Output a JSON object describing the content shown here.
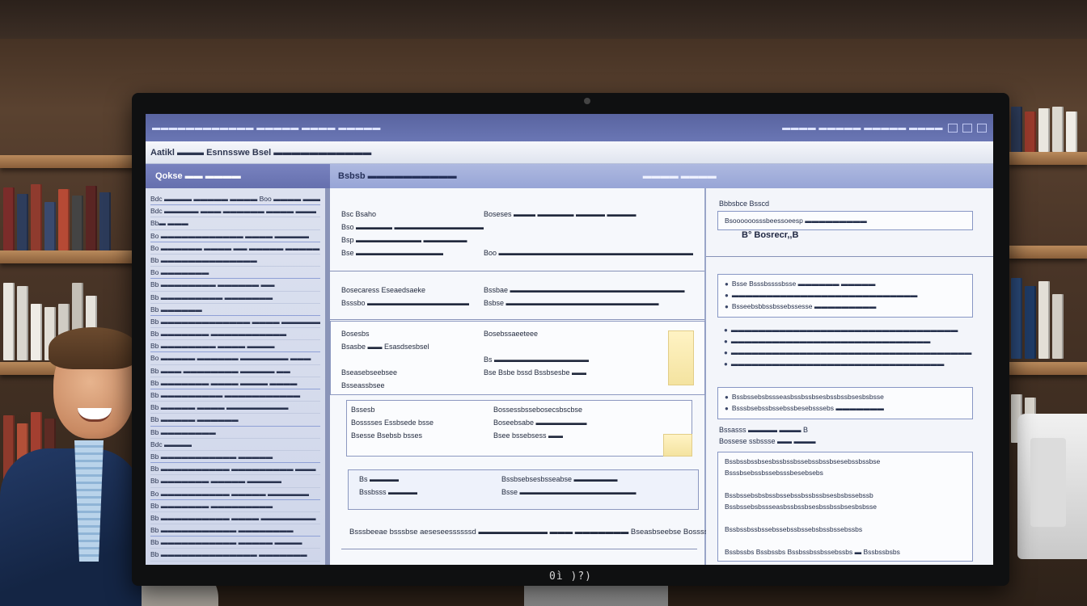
{
  "window": {
    "title_left": "▬▬▬▬▬▬▬▬▬▬▬▬ ▬▬▬▬▬ ▬▬▬▬ ▬▬▬▬▬",
    "title_right": "▬▬▬▬ ▬▬▬▬▬ ▬▬▬▬▬ ▬▬▬▬"
  },
  "ribbon": {
    "label": "Aatikl ▬▬▬ Esnnsswe Bsel ▬▬▬▬▬▬▬▬▬▬▬"
  },
  "left_band": {
    "label": "Qokse ▬▬ ▬▬▬▬"
  },
  "main_band": {
    "label": "Bsbsb ▬▬▬▬▬▬▬▬▬▬",
    "tab": "▬▬▬▬ ▬▬▬▬"
  },
  "left_pane": {
    "items": [
      "Bdc ▬▬▬▬ ▬▬▬▬▬ ▬▬▬▬ Boo ▬▬▬▬ ▬▬▬▬ ▬▬",
      "Bdc ▬▬▬▬▬ ▬▬▬ ▬▬▬▬▬▬ ▬▬▬▬ ▬▬▬",
      "Bb▬ ▬▬▬",
      "Bo ▬▬▬▬▬▬▬▬▬▬▬▬ ▬▬▬▬ ▬▬▬▬▬",
      "Bo ▬▬▬▬▬▬ ▬▬▬▬ ▬▬ ▬▬▬▬▬ ▬▬▬▬▬",
      "Bb ▬▬▬▬▬▬▬▬▬▬▬▬▬▬",
      "Bo ▬▬▬▬▬▬▬",
      "Bb ▬▬▬▬▬▬▬▬ ▬▬▬▬▬▬ ▬▬",
      "Bb ▬▬▬▬▬▬▬▬▬ ▬▬▬▬▬▬▬",
      "Bb ▬▬▬▬▬▬",
      "Bb ▬▬▬▬▬▬▬▬▬▬▬▬▬ ▬▬▬▬ ▬▬▬▬▬▬",
      "Bb ▬▬▬▬▬▬▬ ▬▬▬▬▬▬▬▬▬▬▬",
      "Bb ▬▬▬▬▬▬▬▬ ▬▬▬▬ ▬▬▬▬",
      "Bo ▬▬▬▬▬ ▬▬▬▬▬▬ ▬▬▬▬▬▬▬ ▬▬▬",
      "Bb ▬▬▬ ▬▬▬▬▬▬▬▬ ▬▬▬▬▬ ▬▬",
      "Bb ▬▬▬▬▬▬▬ ▬▬▬▬ ▬▬▬▬ ▬▬▬▬",
      "Bb ▬▬▬▬▬▬▬▬▬ ▬▬▬▬▬▬▬▬▬▬▬",
      "Bb ▬▬▬▬▬ ▬▬▬▬ ▬▬▬▬▬▬▬▬▬",
      "Bb ▬▬▬▬▬ ▬▬▬▬▬▬",
      "Bb ▬▬▬▬▬▬▬▬",
      "Bdc ▬▬▬▬",
      "Bb ▬▬▬▬▬▬▬▬▬▬▬ ▬▬▬▬▬",
      "Bb ▬▬▬▬▬▬▬▬▬▬ ▬▬▬▬▬▬▬▬▬ ▬▬▬",
      "Bb ▬▬▬▬▬▬▬ ▬▬▬▬▬ ▬▬▬▬▬",
      "Bo ▬▬▬▬▬▬▬▬▬▬ ▬▬▬▬▬ ▬▬▬▬▬▬",
      "Bb ▬▬▬▬▬▬▬ ▬▬▬▬▬▬▬▬▬",
      "Bb ▬▬▬▬▬▬▬▬▬▬ ▬▬▬▬ ▬▬▬▬▬▬▬▬",
      "Bb ▬▬▬▬▬▬▬▬▬▬▬ ▬▬▬▬▬▬▬▬",
      "Bb ▬▬▬▬▬▬▬▬▬▬▬ ▬▬▬▬▬ ▬▬▬▬",
      "Bb ▬▬▬▬▬▬▬▬▬▬▬▬▬▬ ▬▬▬▬▬▬▬",
      "Bb ▬▬▬▬▬▬▬ ▬▬▬▬▬▬▬▬▬ ▬▬▬",
      "Bb ▬▬▬▬▬▬▬▬▬▬▬ ▬▬▬▬▬▬"
    ]
  },
  "mid_pane": {
    "rows_a": [
      [
        "Bsc Bsaho",
        "Boseses ▬▬▬ ▬▬▬▬▬ ▬▬▬▬ ▬▬▬▬"
      ],
      [
        "Bso ▬▬▬▬▬ ▬▬▬▬▬▬▬▬▬▬▬▬▬",
        ""
      ],
      [
        "Bsp ▬▬▬▬▬▬▬▬▬ ▬▬▬▬▬▬",
        ""
      ],
      [
        "Bse ▬▬▬▬▬▬▬▬▬▬▬▬",
        "Boo ▬▬▬▬▬▬▬▬▬▬▬▬▬▬▬▬▬▬▬▬▬▬▬▬▬▬▬"
      ]
    ],
    "rows_b": [
      [
        "Bosecaress Eseaedsaeke",
        "Bssbae ▬▬▬▬▬▬▬▬▬▬▬▬▬▬▬▬▬▬▬▬▬▬▬▬"
      ],
      [
        "Bsssbo ▬▬▬▬▬▬▬▬▬▬▬▬▬▬",
        "Bsbse ▬▬▬▬▬▬▬▬▬▬▬▬▬▬▬▬▬▬▬▬▬"
      ]
    ],
    "rows_c": [
      [
        "Bosesbs",
        "Bosebssaeeteee"
      ],
      [
        "Bsasbe ▬▬ Esasdsesbsel",
        ""
      ],
      [
        "",
        "Bs ▬▬▬▬▬▬▬▬▬▬▬▬▬"
      ],
      [
        "Bseasebseebsee",
        "Bse Bsbe bssd Bssbsesbe ▬▬"
      ],
      [
        "Bsseassbsee",
        ""
      ]
    ],
    "rows_d": [
      [
        "Bssesb",
        "Bossessbssebosecsbscbse"
      ],
      [
        "Bosssses Essbsede bsse",
        "Boseebsabe ▬▬▬▬▬▬▬"
      ],
      [
        "Bsesse Bsebsb bsses",
        "Bsee bssebsess ▬▬"
      ]
    ],
    "rows_e": [
      [
        "Bs ▬▬▬▬",
        "Bssbsebsesbsseabse ▬▬▬▬▬▬"
      ],
      [
        "Bssbsss ▬▬▬▬",
        "Bsse ▬▬▬▬▬▬▬▬▬▬▬▬▬▬▬▬"
      ]
    ],
    "footer": "Bsssbeeae bsssbse aeseseessssssd ▬▬▬▬▬▬▬▬▬ ▬▬▬ ▬▬▬▬▬▬▬ Bseasbseebse Bosssseoed ▬▬▬"
  },
  "right_pane": {
    "top_label": "Bbbsbce Bsscd",
    "top_field": "Bsoooooosssbeessoeesp ▬▬▬▬▬▬▬▬▬",
    "heading": "B° Bosrecr,,B",
    "box1": [
      "Bsse Bsssbssssbsse ▬▬▬▬▬▬ ▬▬▬▬▬",
      "▬▬▬▬▬▬▬▬▬▬▬▬▬▬▬▬▬▬▬▬▬▬▬▬▬▬▬",
      "Bsseebsbbssbssebssesse ▬▬▬▬▬▬▬▬▬"
    ],
    "list1": [
      "▬▬▬▬▬▬▬▬▬▬▬▬▬▬▬▬▬▬▬▬▬▬▬▬▬▬▬▬▬▬▬▬▬",
      "▬▬▬▬▬▬▬▬▬▬▬▬▬▬▬▬▬▬▬▬▬▬▬▬▬▬▬▬▬",
      "▬▬▬▬▬▬▬▬▬▬▬▬▬▬▬▬▬▬▬▬▬▬▬▬▬▬▬▬▬▬▬▬▬▬▬",
      "▬▬▬▬▬▬▬▬▬▬▬▬▬▬▬▬▬▬▬▬▬▬▬▬▬▬▬▬▬▬▬"
    ],
    "box2": [
      "Bssbssebsbssseasbssbssbsesbssbssbsesbsbsse",
      "Bsssbsebssbssebssbesebsssebs ▬▬▬▬▬▬▬"
    ],
    "mid_label": "Bssasss ▬▬▬▬ ▬▬▬ B",
    "mid_label2": "Bossese ssbssse ▬▬ ▬▬▬",
    "box3": [
      "Bssbssbssbsesbssbssbssebssbssbsesebssbssbse",
      "Bsssbsebssbssebsssbesebsebs",
      "",
      "Bssbssebsbsbssbssebssbssbssbsesbsbssebssb",
      "Bssbssebsbssseasbssbssbsesbssbssbsesbsbsse",
      "",
      "Bssbssbssbssebssebssbssebsbssbssebssbs",
      "",
      "Bssbssbs Bssbssbs Bssbssbssbssebssbs ▬ Bssbssbsbs"
    ]
  },
  "monitor": {
    "brand": "0ì )?)"
  },
  "colors": {
    "accent": "#6a76b4",
    "pane_bg": "#dce1ef",
    "border": "#8796c4",
    "note": "#f4e3a0"
  }
}
